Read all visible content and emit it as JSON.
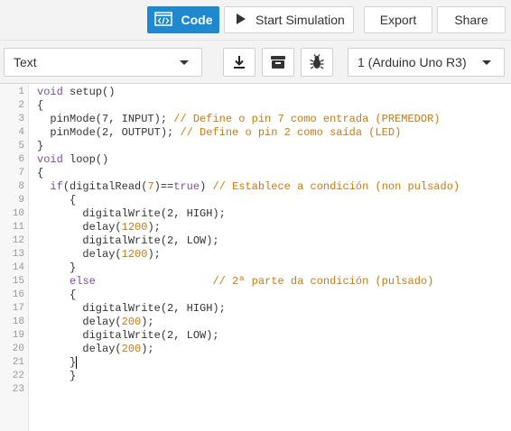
{
  "header": {
    "code_label": "Code",
    "start_simulation_label": "Start Simulation",
    "export_label": "Export",
    "share_label": "Share"
  },
  "toolbar": {
    "mode_value": "Text",
    "board_value": "1 (Arduino Uno R3)",
    "icons": [
      "download-icon",
      "library-icon",
      "debugger-bug-icon"
    ]
  },
  "editor": {
    "line_numbers": [
      "1",
      "2",
      "3",
      "4",
      "5",
      "6",
      "7",
      "8",
      "9",
      "10",
      "11",
      "12",
      "13",
      "14",
      "15",
      "16",
      "17",
      "18",
      "19",
      "20",
      "21",
      "22",
      "23"
    ],
    "lines": [
      "void setup()",
      "{",
      "  pinMode(7, INPUT); // Define o pin 7 como entrada (PREMEDOR)",
      "  pinMode(2, OUTPUT); // Define o pin 2 como saída (LED)",
      "}",
      "void loop()",
      "{",
      "  if(digitalRead(7)==true) // Establece a condición (non pulsado)",
      "     {",
      "       digitalWrite(2, HIGH);",
      "       delay(1200);",
      "       digitalWrite(2, LOW);",
      "       delay(1200);",
      "     }",
      "     else                  // 2ª parte da condición (pulsado)",
      "     {",
      "       digitalWrite(2, HIGH);",
      "       delay(200);",
      "       digitalWrite(2, LOW);",
      "       delay(200);",
      "     }",
      "     }",
      ""
    ]
  },
  "colors": {
    "accent": "#1e88d0",
    "keyword": "#7a4ca8",
    "number_comment": "#c97a14"
  }
}
